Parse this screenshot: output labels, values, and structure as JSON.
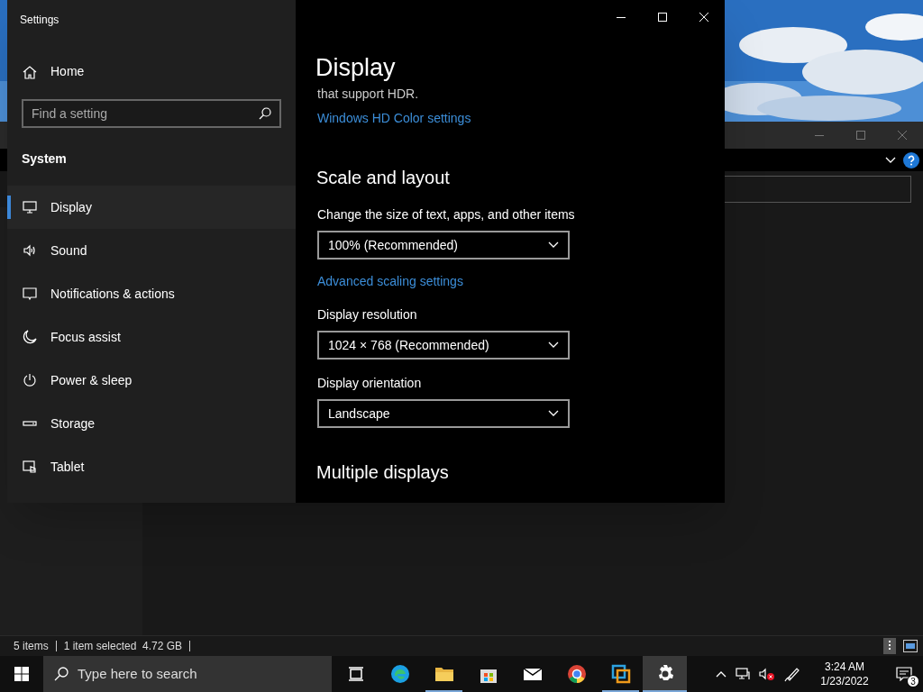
{
  "explorer_window": {
    "status_bar": [
      "5 items",
      "1 item selected  4.72 GB"
    ]
  },
  "settings_window": {
    "title": "Settings",
    "home": "Home",
    "search": {
      "placeholder": "Find a setting"
    },
    "section": "System",
    "nav_items": [
      {
        "label": "Display",
        "selected": true
      },
      {
        "label": "Sound",
        "selected": false
      },
      {
        "label": "Notifications & actions",
        "selected": false
      },
      {
        "label": "Focus assist",
        "selected": false
      },
      {
        "label": "Power & sleep",
        "selected": false
      },
      {
        "label": "Storage",
        "selected": false
      },
      {
        "label": "Tablet",
        "selected": false
      }
    ],
    "page_title": "Display",
    "blocks": [
      {
        "kind": "text",
        "text": "that support HDR."
      },
      {
        "kind": "link",
        "text": "Windows HD Color settings"
      },
      {
        "kind": "heading",
        "text": "Scale and layout"
      },
      {
        "kind": "label",
        "text": "Change the size of text, apps, and other items"
      },
      {
        "kind": "dropdown",
        "text": "100% (Recommended)"
      },
      {
        "kind": "link",
        "text": "Advanced scaling settings"
      },
      {
        "kind": "label",
        "text": "Display resolution"
      },
      {
        "kind": "dropdown",
        "text": "1024 × 768 (Recommended)"
      },
      {
        "kind": "label",
        "text": "Display orientation"
      },
      {
        "kind": "dropdown",
        "text": "Landscape"
      },
      {
        "kind": "heading",
        "text": "Multiple displays"
      }
    ]
  },
  "taskbar": {
    "search": {
      "placeholder": "Type here to search"
    },
    "apps": [
      {
        "running": false,
        "selected": false
      },
      {
        "running": false,
        "selected": false
      },
      {
        "running": true,
        "selected": false
      },
      {
        "running": false,
        "selected": false
      },
      {
        "running": false,
        "selected": false
      },
      {
        "running": false,
        "selected": false
      },
      {
        "running": true,
        "selected": false
      },
      {
        "running": true,
        "selected": true
      }
    ],
    "time": "3:24 AM",
    "date": "1/23/2022",
    "notification_count": "3"
  }
}
